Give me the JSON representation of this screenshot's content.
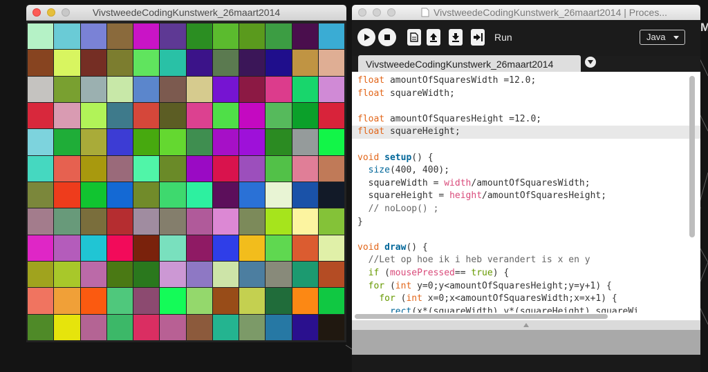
{
  "sketch_window": {
    "title": "VivstweedeCodingKunstwerk_26maart2014",
    "grid_colors": [
      [
        "#b5f2c6",
        "#6acbd6",
        "#7a82d6",
        "#8a6a3c",
        "#c914c6",
        "#5e3994",
        "#2b8e22",
        "#5bbb2e",
        "#5a9a1d",
        "#3c9d43",
        "#4a0e4d",
        "#3aacd4"
      ],
      [
        "#874420",
        "#d8f560",
        "#752e24",
        "#7c7d2f",
        "#60e45e",
        "#29c1a6",
        "#3b1389",
        "#5b7a50",
        "#3b1658",
        "#1f0e8c",
        "#c09443",
        "#dfae94"
      ],
      [
        "#c5c3c0",
        "#79a030",
        "#9bb0b0",
        "#c8e8a8",
        "#5b86cc",
        "#7c5a4f",
        "#d6cb8e",
        "#7614d2",
        "#8c1944",
        "#dc3c8c",
        "#18d66c",
        "#d08ad6"
      ],
      [
        "#d8283c",
        "#d99bb2",
        "#b1f358",
        "#3e7a8b",
        "#d5473a",
        "#5c5d24",
        "#dc4190",
        "#4fdf48",
        "#c409c1",
        "#56ba5c",
        "#0ba02a",
        "#d8233a"
      ],
      [
        "#7dd3dd",
        "#1fad38",
        "#a9ab39",
        "#3c3cd4",
        "#47a90f",
        "#64d830",
        "#3f8e50",
        "#a610c7",
        "#9e11d9",
        "#2b8b22",
        "#959b9b",
        "#12f548"
      ],
      [
        "#45d8c0",
        "#e66150",
        "#a8990e",
        "#9a6a7a",
        "#50f5a8",
        "#6a8a28",
        "#9a0ac4",
        "#d9134d",
        "#9c4fbc",
        "#52c148",
        "#e07e97",
        "#c07a58"
      ],
      [
        "#7b873b",
        "#ee3c1c",
        "#11c430",
        "#1469d4",
        "#718b2a",
        "#3ed96e",
        "#2df0a0",
        "#5c0f5b",
        "#2a71d6",
        "#e8f4d4",
        "#1a52a8",
        "#121a28"
      ],
      [
        "#a37c8c",
        "#689a7a",
        "#7a6e3c",
        "#b52d30",
        "#a08ca0",
        "#847e6c",
        "#b05a9a",
        "#dc88d4",
        "#7c8a5a",
        "#a6e41c",
        "#fcf4a0",
        "#84c238"
      ],
      [
        "#df26c6",
        "#b45cbb",
        "#20c5d4",
        "#f20b5a",
        "#7a220c",
        "#79e0be",
        "#8f1a64",
        "#2f3ee8",
        "#f2bd1c",
        "#5fd850",
        "#db5c30",
        "#e0f0a8"
      ],
      [
        "#a0a31e",
        "#a8c82a",
        "#bb6aa8",
        "#4a7914",
        "#2a781d",
        "#cc98d4",
        "#8e78c4",
        "#cde4a8",
        "#4c7ea0",
        "#888a7a",
        "#1c9a70",
        "#b44c24"
      ],
      [
        "#f07460",
        "#f0a038",
        "#fb5a10",
        "#4fc87c",
        "#8c4a70",
        "#14fb58",
        "#94d86c",
        "#984c18",
        "#c4d050",
        "#206c3a",
        "#fc8814",
        "#10c842"
      ],
      [
        "#4f8a28",
        "#e6e40c",
        "#b46494",
        "#3cb868",
        "#da2e62",
        "#b86094",
        "#8c5a3c",
        "#24b490",
        "#7c9a68",
        "#2678a4",
        "#2a108e",
        "#201810"
      ]
    ]
  },
  "ide_window": {
    "title": "VivstweedeCodingKunstwerk_26maart2014 | Proces...",
    "toolbar": {
      "run_label": "Run",
      "mode": "Java"
    },
    "tab_label": "VivstweedeCodingKunstwerk_26maart2014",
    "code_lines": [
      "float amountOfSquaresWidth =12.0;",
      "float squareWidth;",
      "",
      "float amountOfSquaresHeight =12.0;",
      "float squareHeight;",
      "",
      "void setup() {",
      "  size(400, 400);",
      "  squareWidth = width/amountOfSquaresWidth;",
      "  squareHeight = height/amountOfSquaresHeight;",
      "  // noLoop() ;",
      "}",
      "",
      "void draw() {",
      "  //Let op hoe ik i heb verandert is x en y",
      "  if (mousePressed== true) {",
      "  for (int y=0;y<amountOfSquaresHeight;y=y+1) {",
      "    for (int x=0;x<amountOfSquaresWidth;x=x+1) {",
      "      rect(x*(squareWidth),y*(squareHeight),squareWi"
    ],
    "highlighted_line": 4
  },
  "desktop_edge_text": "M",
  "colors": {
    "toolbar_bg": "#1b1b1b",
    "editor_bg": "#ffffff",
    "type_keyword": "#e2661a",
    "control_keyword": "#669900",
    "function": "#006699",
    "builtin_var": "#d94a7a",
    "comment": "#666666"
  }
}
